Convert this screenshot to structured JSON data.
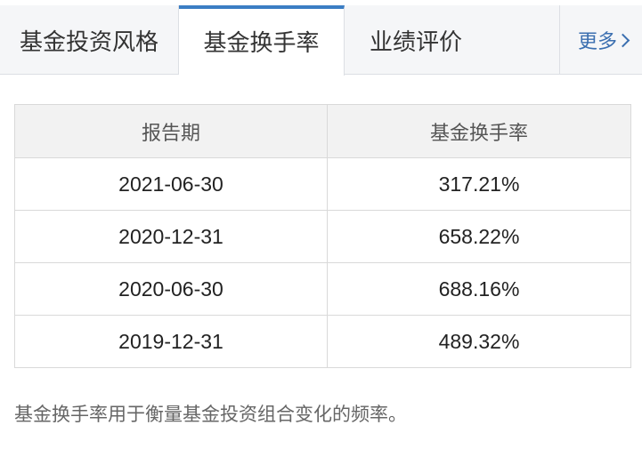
{
  "tabs": {
    "style": "基金投资风格",
    "turnover": "基金换手率",
    "performance": "业绩评价",
    "more": "更多"
  },
  "table": {
    "headers": [
      "报告期",
      "基金换手率"
    ],
    "rows": [
      {
        "period": "2021-06-30",
        "rate": "317.21%"
      },
      {
        "period": "2020-12-31",
        "rate": "658.22%"
      },
      {
        "period": "2020-06-30",
        "rate": "688.16%"
      },
      {
        "period": "2019-12-31",
        "rate": "489.32%"
      }
    ]
  },
  "note": "基金换手率用于衡量基金投资组合变化的频率。",
  "colors": {
    "active_tab_accent": "#3b7dc4",
    "more_link": "#3b6fb0"
  }
}
